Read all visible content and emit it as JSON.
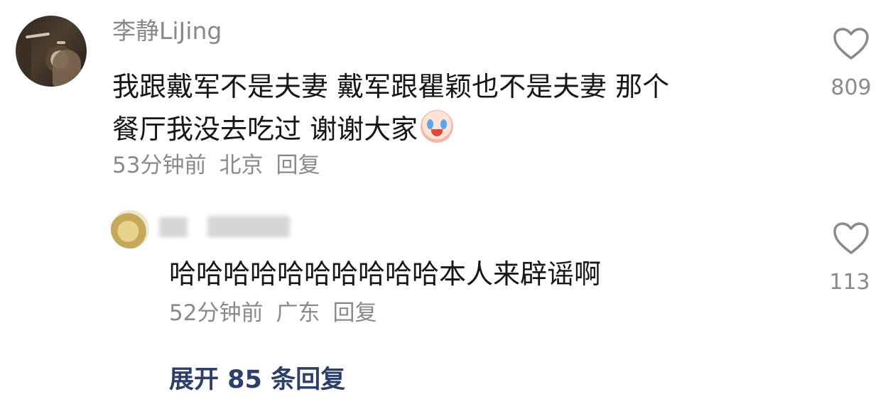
{
  "comment": {
    "username": "李静LiJing",
    "text_line1": "我跟戴军不是夫妻 戴军跟瞿颖也不是夫妻 那个",
    "text_line2": "餐厅我没去吃过 谢谢大家",
    "time": "53分钟前",
    "location": "北京",
    "reply_label": "回复",
    "likes": "809",
    "emoji_icon": "crying-face-icon"
  },
  "reply": {
    "text": "哈哈哈哈哈哈哈哈哈哈本人来辟谣啊",
    "time": "52分钟前",
    "location": "广东",
    "reply_label": "回复",
    "likes": "113"
  },
  "expand_label": "展开 85 条回复"
}
